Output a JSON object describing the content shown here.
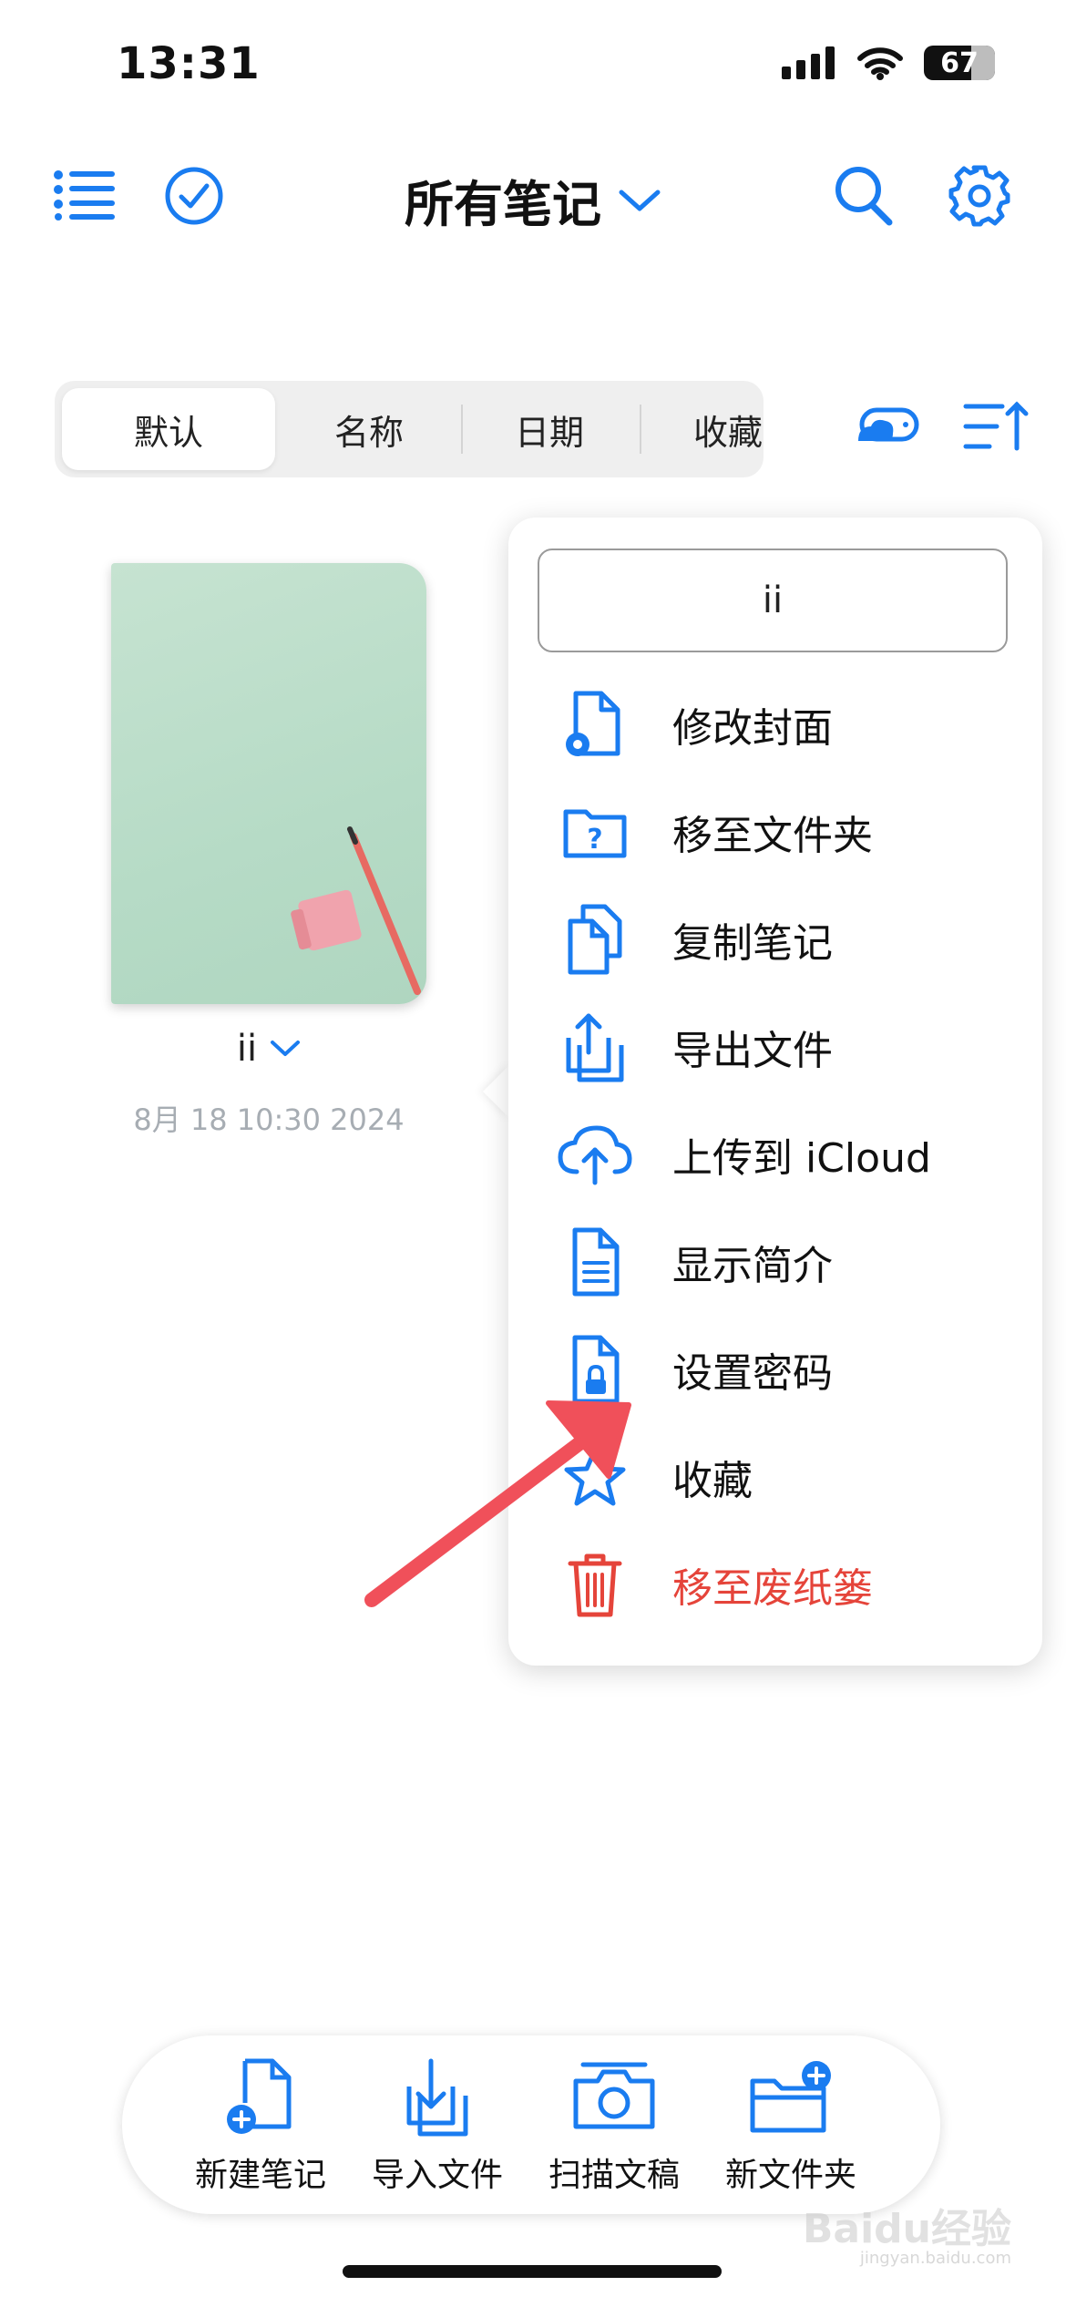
{
  "status_bar": {
    "time": "13:31",
    "battery": "67"
  },
  "header": {
    "title": "所有笔记",
    "icons": [
      "list-icon",
      "checkmark-circle-icon",
      "chevron-down-icon",
      "search-icon",
      "gear-icon"
    ]
  },
  "sort_segments": [
    {
      "label": "默认",
      "selected": true
    },
    {
      "label": "名称",
      "selected": false
    },
    {
      "label": "日期",
      "selected": false
    },
    {
      "label": "收藏",
      "selected": false
    }
  ],
  "note": {
    "name": "ii",
    "date": "8月 18 10:30 2024"
  },
  "context_menu": {
    "rename_value": "ii",
    "items": [
      {
        "label": "修改封面",
        "icon": "document-gear-icon"
      },
      {
        "label": "移至文件夹",
        "icon": "folder-question-icon"
      },
      {
        "label": "复制笔记",
        "icon": "duplicate-document-icon"
      },
      {
        "label": "导出文件",
        "icon": "share-export-icon"
      },
      {
        "label": "上传到 iCloud",
        "icon": "cloud-upload-icon"
      },
      {
        "label": "显示简介",
        "icon": "document-info-icon"
      },
      {
        "label": "设置密码",
        "icon": "document-lock-icon"
      },
      {
        "label": "收藏",
        "icon": "star-icon"
      },
      {
        "label": "移至废纸篓",
        "icon": "trash-icon",
        "danger": true
      }
    ]
  },
  "toolbar": {
    "items": [
      {
        "label": "新建笔记",
        "icon": "new-note-icon"
      },
      {
        "label": "导入文件",
        "icon": "import-file-icon"
      },
      {
        "label": "扫描文稿",
        "icon": "camera-scan-icon"
      },
      {
        "label": "新文件夹",
        "icon": "new-folder-icon"
      }
    ]
  },
  "colors": {
    "accent": "#1a7cf0",
    "danger": "#e5443a",
    "annotation": "#f0505a"
  },
  "watermark": {
    "text": "Baidu经验",
    "sub": "jingyan.baidu.com"
  }
}
